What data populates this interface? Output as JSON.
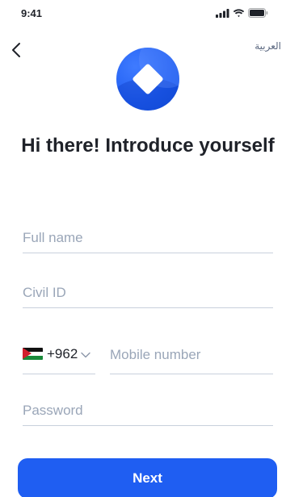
{
  "status_bar": {
    "time": "9:41",
    "signal_icon": "cellular-signal-icon",
    "wifi_icon": "wifi-icon",
    "battery_icon": "battery-icon"
  },
  "header": {
    "back_icon": "chevron-left-icon",
    "language_label": "العربية"
  },
  "logo_icon": "app-logo-icon",
  "title": "Hi there! Introduce yourself",
  "form": {
    "full_name_placeholder": "Full name",
    "civil_id_placeholder": "Civil ID",
    "country_code": "+962",
    "country_flag": "jordan-flag-icon",
    "mobile_placeholder": "Mobile number",
    "password_placeholder": "Password"
  },
  "next_label": "Next",
  "colors": {
    "primary": "#1f5ef2",
    "text": "#1f2229",
    "placeholder": "#9aa6b8",
    "divider": "#c8d0dc"
  }
}
